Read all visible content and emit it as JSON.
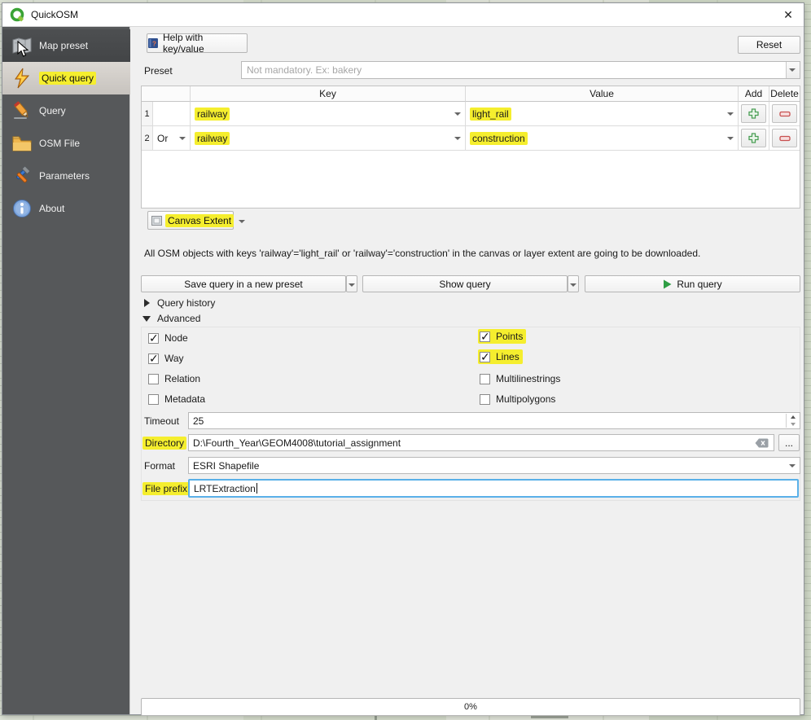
{
  "window": {
    "title": "QuickOSM",
    "close_glyph": "✕"
  },
  "sidebar": {
    "items": [
      {
        "id": "map-preset",
        "label": "Map preset",
        "state": "hover"
      },
      {
        "id": "quick-query",
        "label": "Quick query",
        "state": "selected",
        "highlighted": true
      },
      {
        "id": "query",
        "label": "Query",
        "state": "normal"
      },
      {
        "id": "osm-file",
        "label": "OSM File",
        "state": "normal"
      },
      {
        "id": "parameters",
        "label": "Parameters",
        "state": "normal"
      },
      {
        "id": "about",
        "label": "About",
        "state": "normal"
      }
    ]
  },
  "toolbar": {
    "help_label": "Help with key/value",
    "reset_label": "Reset"
  },
  "preset": {
    "label": "Preset",
    "placeholder": "Not mandatory. Ex: bakery"
  },
  "query_table": {
    "headers": {
      "key": "Key",
      "value": "Value",
      "add": "Add",
      "delete": "Delete"
    },
    "rows": [
      {
        "num": "1",
        "op": "",
        "key": "railway",
        "value": "light_rail"
      },
      {
        "num": "2",
        "op": "Or",
        "key": "railway",
        "value": "construction"
      }
    ]
  },
  "extent": {
    "label": "Canvas Extent"
  },
  "info_text": "All OSM objects with keys 'railway'='light_rail' or 'railway'='construction' in the canvas or layer extent are going to be downloaded.",
  "actions": {
    "save_label": "Save query in a new preset",
    "show_label": "Show query",
    "run_label": "Run query"
  },
  "sections": {
    "query_history": "Query history",
    "advanced": "Advanced"
  },
  "advanced": {
    "osm_types": [
      {
        "label": "Node",
        "checked": true
      },
      {
        "label": "Way",
        "checked": true
      },
      {
        "label": "Relation",
        "checked": false
      },
      {
        "label": "Metadata",
        "checked": false
      }
    ],
    "geometry_types": [
      {
        "label": "Points",
        "checked": true,
        "highlighted": true
      },
      {
        "label": "Lines",
        "checked": true,
        "highlighted": true
      },
      {
        "label": "Multilinestrings",
        "checked": false
      },
      {
        "label": "Multipolygons",
        "checked": false
      }
    ],
    "timeout": {
      "label": "Timeout",
      "value": "25"
    },
    "directory": {
      "label": "Directory",
      "value": "D:\\Fourth_Year\\GEOM4008\\tutorial_assignment",
      "browse_label": "..."
    },
    "format": {
      "label": "Format",
      "value": "ESRI Shapefile"
    },
    "file_prefix": {
      "label": "File prefix",
      "value": "LRTExtraction"
    }
  },
  "progress": {
    "label": "0%"
  },
  "colors": {
    "highlight": "#f5ee2e",
    "sidebar_bg": "#56585a",
    "run_green": "#2f9e44",
    "add_green": "#4a9e55",
    "delete_red": "#c75050",
    "focus_blue": "#5ab0e8"
  }
}
